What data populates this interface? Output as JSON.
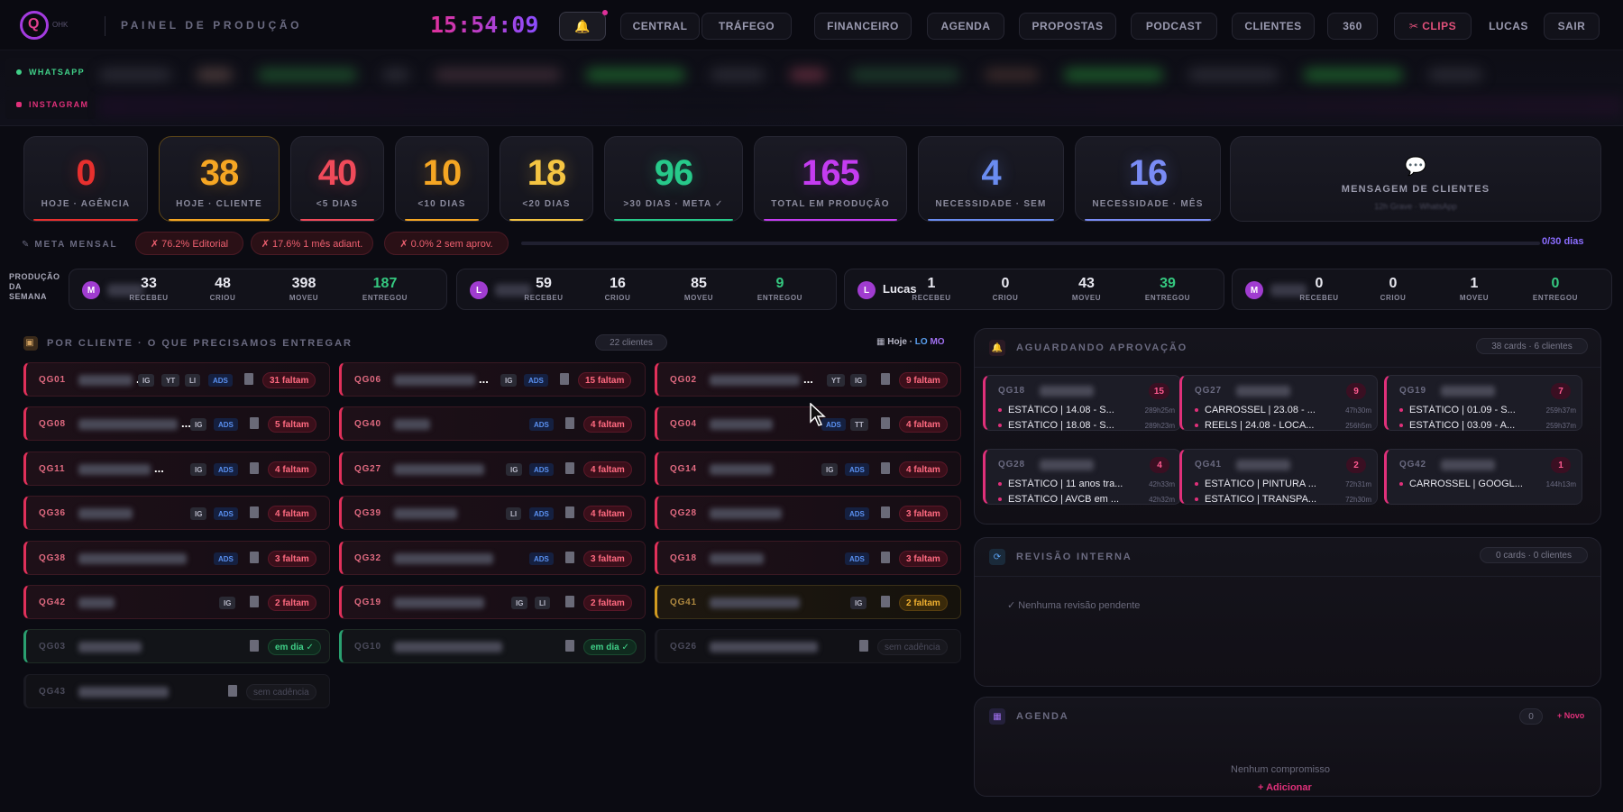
{
  "header": {
    "logo_text": "OHK",
    "page_title": "PAINEL DE PRODUÇÃO",
    "clock": "15:54:09",
    "bell_icon": "bell-icon",
    "nav": [
      "CENTRAL",
      "TRÁFEGO",
      "FINANCEIRO",
      "AGENDA",
      "PROPOSTAS",
      "PODCAST",
      "CLIENTES",
      "360",
      "✂ CLIPS",
      "LUCAS",
      "SAIR"
    ]
  },
  "social": {
    "whatsapp": "WHATSAPP",
    "instagram": "INSTAGRAM"
  },
  "stats": [
    {
      "value": "0",
      "label": "HOJE · AGÊNCIA",
      "color": "#e8302e"
    },
    {
      "value": "38",
      "label": "HOJE · CLIENTE",
      "color": "#f5a623"
    },
    {
      "value": "40",
      "label": "<5 DIAS",
      "color": "#f04a5a"
    },
    {
      "value": "10",
      "label": "<10 DIAS",
      "color": "#f5a623"
    },
    {
      "value": "18",
      "label": "<20 DIAS",
      "color": "#f5c542"
    },
    {
      "value": "96",
      "label": ">30 DIAS · META ✓",
      "color": "#27c98a"
    },
    {
      "value": "165",
      "label": "TOTAL EM PRODUÇÃO",
      "color": "#c43cf0"
    },
    {
      "value": "4",
      "label": "NECESSIDADE · SEM",
      "color": "#6a8cf0"
    },
    {
      "value": "16",
      "label": "NECESSIDADE · MÊS",
      "color": "#7a8cf5"
    }
  ],
  "message_card": {
    "label": "MENSAGEM DE CLIENTES",
    "sub": "12h Grave · WhatsApp"
  },
  "meta": {
    "label": "META MENSAL",
    "pills": [
      "✗ 76.2% Editorial",
      "✗ 17.6% 1 mês adiant.",
      "✗ 0.0% 2 sem aprov."
    ],
    "days": "0/30 dias"
  },
  "production": {
    "label": [
      "PRODUÇÃO",
      "DA",
      "SEMANA"
    ],
    "col_labels": [
      "RECEBEU",
      "CRIOU",
      "MOVEU",
      "ENTREGOU"
    ],
    "members": [
      {
        "initial": "M",
        "name": "",
        "values": [
          "33",
          "48",
          "398",
          "187"
        ]
      },
      {
        "initial": "L",
        "name": "",
        "values": [
          "59",
          "16",
          "85",
          "9"
        ]
      },
      {
        "initial": "L",
        "name": "Lucas",
        "values": [
          "1",
          "0",
          "43",
          "39"
        ]
      },
      {
        "initial": "M",
        "name": "",
        "values": [
          "0",
          "0",
          "1",
          "0"
        ]
      }
    ]
  },
  "clients_section": {
    "title": "POR CLIENTE · O QUE PRECISAMOS ENTREGAR",
    "count": "22 clientes",
    "today_label": "Hoje ·",
    "today_lo": "LO",
    "today_mo": "MO",
    "cards": [
      {
        "code": "QG01",
        "tags": [
          "IG",
          "YT",
          "LI",
          "ADS"
        ],
        "badge": "31 faltam",
        "style": "red",
        "dots": "..."
      },
      {
        "code": "QG06",
        "tags": [
          "IG",
          "ADS"
        ],
        "badge": "15 faltam",
        "style": "red",
        "dots": "..."
      },
      {
        "code": "QG02",
        "tags": [
          "YT",
          "IG"
        ],
        "badge": "9 faltam",
        "style": "red",
        "dots": "..."
      },
      {
        "code": "QG08",
        "tags": [
          "IG",
          "ADS"
        ],
        "badge": "5 faltam",
        "style": "red",
        "dots": "..."
      },
      {
        "code": "QG40",
        "tags": [
          "ADS"
        ],
        "badge": "4 faltam",
        "style": "red",
        "dots": ""
      },
      {
        "code": "QG04",
        "tags": [
          "ADS",
          "TT"
        ],
        "badge": "4 faltam",
        "style": "red",
        "dots": ""
      },
      {
        "code": "QG11",
        "tags": [
          "IG",
          "ADS"
        ],
        "badge": "4 faltam",
        "style": "red",
        "dots": "..."
      },
      {
        "code": "QG27",
        "tags": [
          "IG",
          "ADS"
        ],
        "badge": "4 faltam",
        "style": "red",
        "dots": ""
      },
      {
        "code": "QG14",
        "tags": [
          "IG",
          "ADS"
        ],
        "badge": "4 faltam",
        "style": "red",
        "dots": ""
      },
      {
        "code": "QG36",
        "tags": [
          "IG",
          "ADS"
        ],
        "badge": "4 faltam",
        "style": "red",
        "dots": ""
      },
      {
        "code": "QG39",
        "tags": [
          "LI",
          "ADS"
        ],
        "badge": "4 faltam",
        "style": "red",
        "dots": ""
      },
      {
        "code": "QG28",
        "tags": [
          "ADS"
        ],
        "badge": "3 faltam",
        "style": "red",
        "dots": ""
      },
      {
        "code": "QG38",
        "tags": [
          "ADS"
        ],
        "badge": "3 faltam",
        "style": "red",
        "dots": ""
      },
      {
        "code": "QG32",
        "tags": [
          "ADS"
        ],
        "badge": "3 faltam",
        "style": "red",
        "dots": ""
      },
      {
        "code": "QG18",
        "tags": [
          "ADS"
        ],
        "badge": "3 faltam",
        "style": "red",
        "dots": ""
      },
      {
        "code": "QG42",
        "tags": [
          "IG"
        ],
        "badge": "2 faltam",
        "style": "red",
        "dots": ""
      },
      {
        "code": "QG19",
        "tags": [
          "IG",
          "LI"
        ],
        "badge": "2 faltam",
        "style": "red",
        "dots": ""
      },
      {
        "code": "QG41",
        "tags": [
          "IG"
        ],
        "badge": "2 faltam",
        "style": "yellow",
        "dots": ""
      },
      {
        "code": "QG03",
        "tags": [],
        "badge": "em dia ✓",
        "style": "green",
        "dots": ""
      },
      {
        "code": "QG10",
        "tags": [],
        "badge": "em dia ✓",
        "style": "green",
        "dots": ""
      },
      {
        "code": "QG26",
        "tags": [],
        "badge": "sem cadência",
        "style": "dim",
        "dots": ""
      },
      {
        "code": "QG43",
        "tags": [],
        "badge": "sem cadência",
        "style": "dim",
        "dots": ""
      }
    ]
  },
  "approval": {
    "title": "AGUARDANDO APROVAÇÃO",
    "count": "38 cards · 6 clientes",
    "cards": [
      {
        "code": "QG18",
        "count": "15",
        "items": [
          {
            "t": "ESTÁTICO | 14.08 - S...",
            "tm": "289h25m"
          },
          {
            "t": "ESTÁTICO | 18.08 - S...",
            "tm": "289h23m"
          }
        ]
      },
      {
        "code": "QG27",
        "count": "9",
        "items": [
          {
            "t": "CARROSSEL | 23.08 - ...",
            "tm": "47h30m"
          },
          {
            "t": "REELS | 24.08 - LOCA...",
            "tm": "256h5m"
          }
        ]
      },
      {
        "code": "QG19",
        "count": "7",
        "items": [
          {
            "t": "ESTÁTICO | 01.09 - S...",
            "tm": "259h37m"
          },
          {
            "t": "ESTÁTICO | 03.09 - A...",
            "tm": "259h37m"
          }
        ]
      },
      {
        "code": "QG28",
        "count": "4",
        "items": [
          {
            "t": "ESTÁTICO | 11 anos tra...",
            "tm": "42h33m"
          },
          {
            "t": "ESTÁTICO | AVCB em ...",
            "tm": "42h32m"
          }
        ]
      },
      {
        "code": "QG41",
        "count": "2",
        "items": [
          {
            "t": "ESTÁTICO | PINTURA ...",
            "tm": "72h31m"
          },
          {
            "t": "ESTÁTICO | TRANSPA...",
            "tm": "72h30m"
          }
        ]
      },
      {
        "code": "QG42",
        "count": "1",
        "items": [
          {
            "t": "CARROSSEL | GOOGL...",
            "tm": "144h13m"
          }
        ]
      }
    ]
  },
  "review": {
    "title": "REVISÃO INTERNA",
    "count": "0 cards · 0 clientes",
    "empty": "✓ Nenhuma revisão pendente"
  },
  "agenda": {
    "title": "AGENDA",
    "count": "0",
    "new": "+ Novo",
    "empty": "Nenhum compromisso",
    "add": "+ Adicionar"
  }
}
